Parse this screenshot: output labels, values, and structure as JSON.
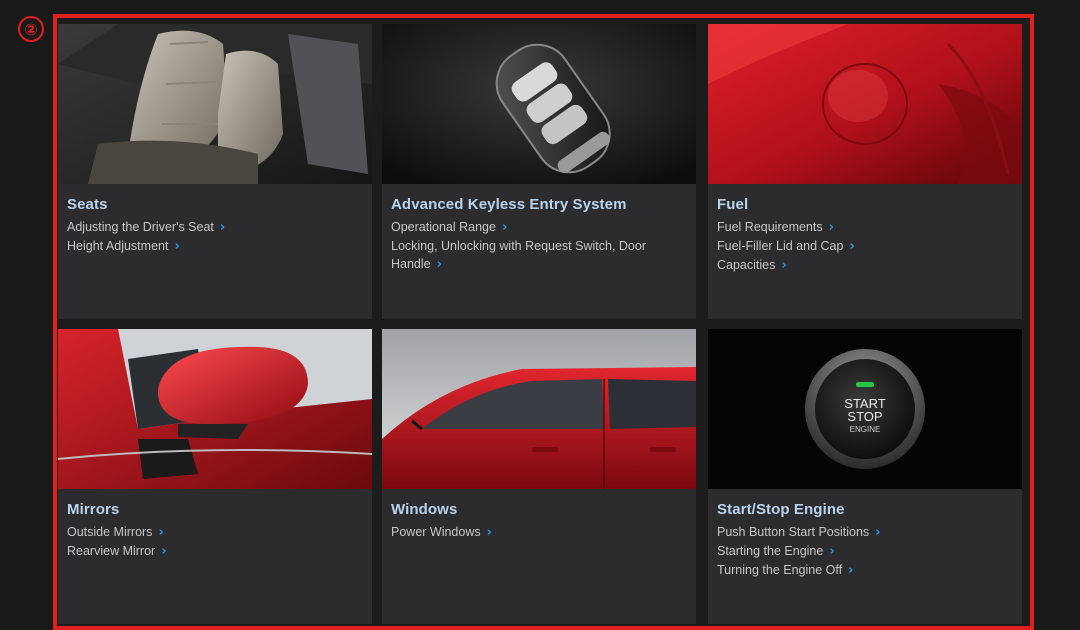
{
  "marker": "②",
  "tiles": [
    {
      "title": "Seats",
      "image": "car-seats-image",
      "links": [
        "Adjusting the Driver's Seat",
        "Height Adjustment"
      ]
    },
    {
      "title": "Advanced Keyless Entry System",
      "image": "smart-key-image",
      "links": [
        "Operational Range",
        "Locking, Unlocking with Request Switch, Door Handle"
      ]
    },
    {
      "title": "Fuel",
      "image": "fuel-lid-image",
      "links": [
        "Fuel Requirements",
        "Fuel-Filler Lid and Cap",
        "Capacities"
      ]
    },
    {
      "title": "Mirrors",
      "image": "side-mirror-image",
      "links": [
        "Outside Mirrors",
        "Rearview Mirror"
      ]
    },
    {
      "title": "Windows",
      "image": "car-windows-image",
      "links": [
        "Power Windows"
      ]
    },
    {
      "title": "Start/Stop Engine",
      "image": "start-stop-button-image",
      "links": [
        "Push Button Start Positions",
        "Starting the Engine",
        "Turning the Engine Off"
      ]
    }
  ],
  "start_button": {
    "line1": "START",
    "line2": "STOP",
    "line3": "ENGINE"
  },
  "chevron_icon": "chevron-right-icon",
  "colors": {
    "highlight": "#e0201c",
    "title": "#b9d3ee",
    "link": "#c7c7c7",
    "chevron": "#2a9be8",
    "tile_bg": "#2c2c2e"
  }
}
